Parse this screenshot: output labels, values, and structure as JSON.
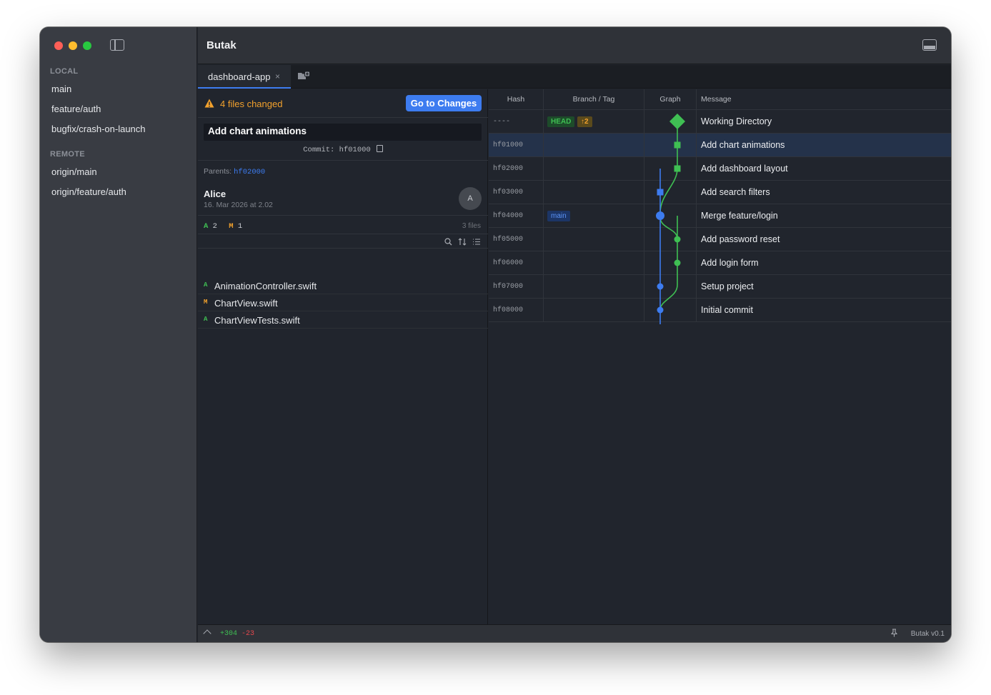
{
  "window": {
    "app_title": "Butak"
  },
  "sidebar": {
    "local_label": "LOCAL",
    "local_branches": [
      "main",
      "feature/auth",
      "bugfix/crash-on-launch"
    ],
    "remote_label": "REMOTE",
    "remote_branches": [
      "origin/main",
      "origin/feature/auth"
    ]
  },
  "tabs": [
    {
      "label": "dashboard-app",
      "close": "×"
    }
  ],
  "detail": {
    "changes_text": "4 files changed",
    "goto_button": "Go to Changes",
    "commit_message": "Add chart animations",
    "commit_label": "Commit: hf01000",
    "parents_label": "Parents:",
    "parent_hash": "hf02000",
    "author": "Alice",
    "date": "16. Mar 2026 at 2.02",
    "avatar_initial": "A",
    "stats": {
      "added_letter": "A",
      "added": "2",
      "modified_letter": "M",
      "modified": "1"
    },
    "files_count": "3 files",
    "files": [
      {
        "status": "A",
        "name": "AnimationController.swift"
      },
      {
        "status": "M",
        "name": "ChartView.swift"
      },
      {
        "status": "A",
        "name": "ChartViewTests.swift"
      }
    ]
  },
  "history": {
    "columns": {
      "hash": "Hash",
      "branch": "Branch / Tag",
      "graph": "Graph",
      "message": "Message"
    },
    "commits": [
      {
        "hash": "----",
        "badges": [
          {
            "text": "HEAD",
            "kind": "head"
          },
          {
            "text": "↑2",
            "kind": "ahead"
          }
        ],
        "message": "Working Directory"
      },
      {
        "hash": "hf01000",
        "badges": [],
        "message": "Add chart animations",
        "selected": true
      },
      {
        "hash": "hf02000",
        "badges": [],
        "message": "Add dashboard layout"
      },
      {
        "hash": "hf03000",
        "badges": [],
        "message": "Add search filters"
      },
      {
        "hash": "hf04000",
        "badges": [
          {
            "text": "main",
            "kind": "branch"
          }
        ],
        "message": "Merge feature/login"
      },
      {
        "hash": "hf05000",
        "badges": [],
        "message": "Add password reset"
      },
      {
        "hash": "hf06000",
        "badges": [],
        "message": "Add login form"
      },
      {
        "hash": "hf07000",
        "badges": [],
        "message": "Setup project"
      },
      {
        "hash": "hf08000",
        "badges": [],
        "message": "Initial commit"
      }
    ]
  },
  "colors": {
    "accent": "#3d7cf0",
    "green": "#3fbf53",
    "orange": "#f2a12d",
    "red": "#e5484d"
  },
  "statusbar": {
    "added": "+304",
    "removed": "-23",
    "version": "Butak v0.1"
  }
}
